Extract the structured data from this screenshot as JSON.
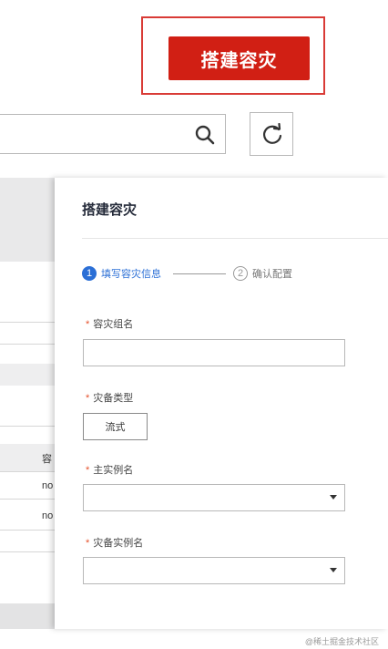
{
  "top": {
    "create_button": "搭建容灾"
  },
  "search": {
    "value": ""
  },
  "background_table": {
    "column_header": "容",
    "rows": [
      "no",
      "no"
    ]
  },
  "drawer": {
    "title": "搭建容灾",
    "steps": [
      {
        "num": "1",
        "label": "填写容灾信息",
        "state": "active"
      },
      {
        "num": "2",
        "label": "确认配置",
        "state": "pending"
      }
    ],
    "fields": {
      "group_name": {
        "required_mark": "*",
        "label": "容灾组名",
        "value": ""
      },
      "dr_type": {
        "required_mark": "*",
        "label": "灾备类型",
        "option": "流式"
      },
      "primary_instance": {
        "required_mark": "*",
        "label": "主实例名",
        "value": ""
      },
      "dr_instance": {
        "required_mark": "*",
        "label": "灾备实例名",
        "value": ""
      }
    }
  },
  "watermark": "@稀土掘金技术社区",
  "colors": {
    "primary_red": "#d11f14",
    "accent_blue": "#2b6fd6",
    "required": "#e6522c"
  }
}
